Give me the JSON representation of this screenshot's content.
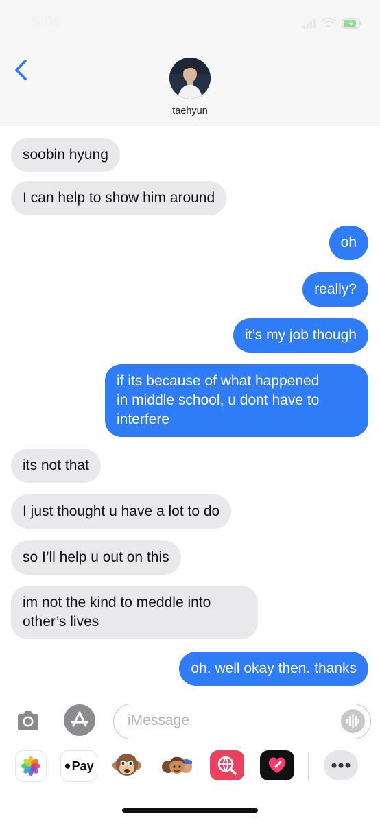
{
  "status_bar": {
    "time": "5:09"
  },
  "header": {
    "contact_name": "taehyun"
  },
  "messages": [
    {
      "side": "in",
      "text": "soobin hyung"
    },
    {
      "side": "in",
      "text": "I can help to show him around"
    },
    {
      "side": "out",
      "text": "oh"
    },
    {
      "side": "out",
      "text": "really?"
    },
    {
      "side": "out",
      "text": "it’s my job though"
    },
    {
      "side": "out",
      "lines": [
        "if its because of what happened",
        "in middle school, u dont have to",
        "interfere"
      ]
    },
    {
      "side": "in",
      "text": "its not that"
    },
    {
      "side": "in",
      "text": "I just thought u have a lot to do"
    },
    {
      "side": "in",
      "text": "so I’ll help u out on this"
    },
    {
      "side": "in",
      "lines": [
        "im not the kind to meddle into",
        "other’s lives"
      ]
    },
    {
      "side": "out",
      "text": "oh. well okay then. thanks"
    }
  ],
  "composer": {
    "placeholder": "iMessage"
  },
  "app_strip": {
    "items": [
      "photos-icon",
      "apple-pay",
      "animoji-icon",
      "memoji-icon",
      "images-search-icon",
      "digital-touch-icon",
      "more-icon"
    ],
    "pay_label": "Pay"
  },
  "colors": {
    "outgoing": "#2f7cf6",
    "incoming": "#e9e9eb",
    "accent": "#2f7cf6"
  }
}
